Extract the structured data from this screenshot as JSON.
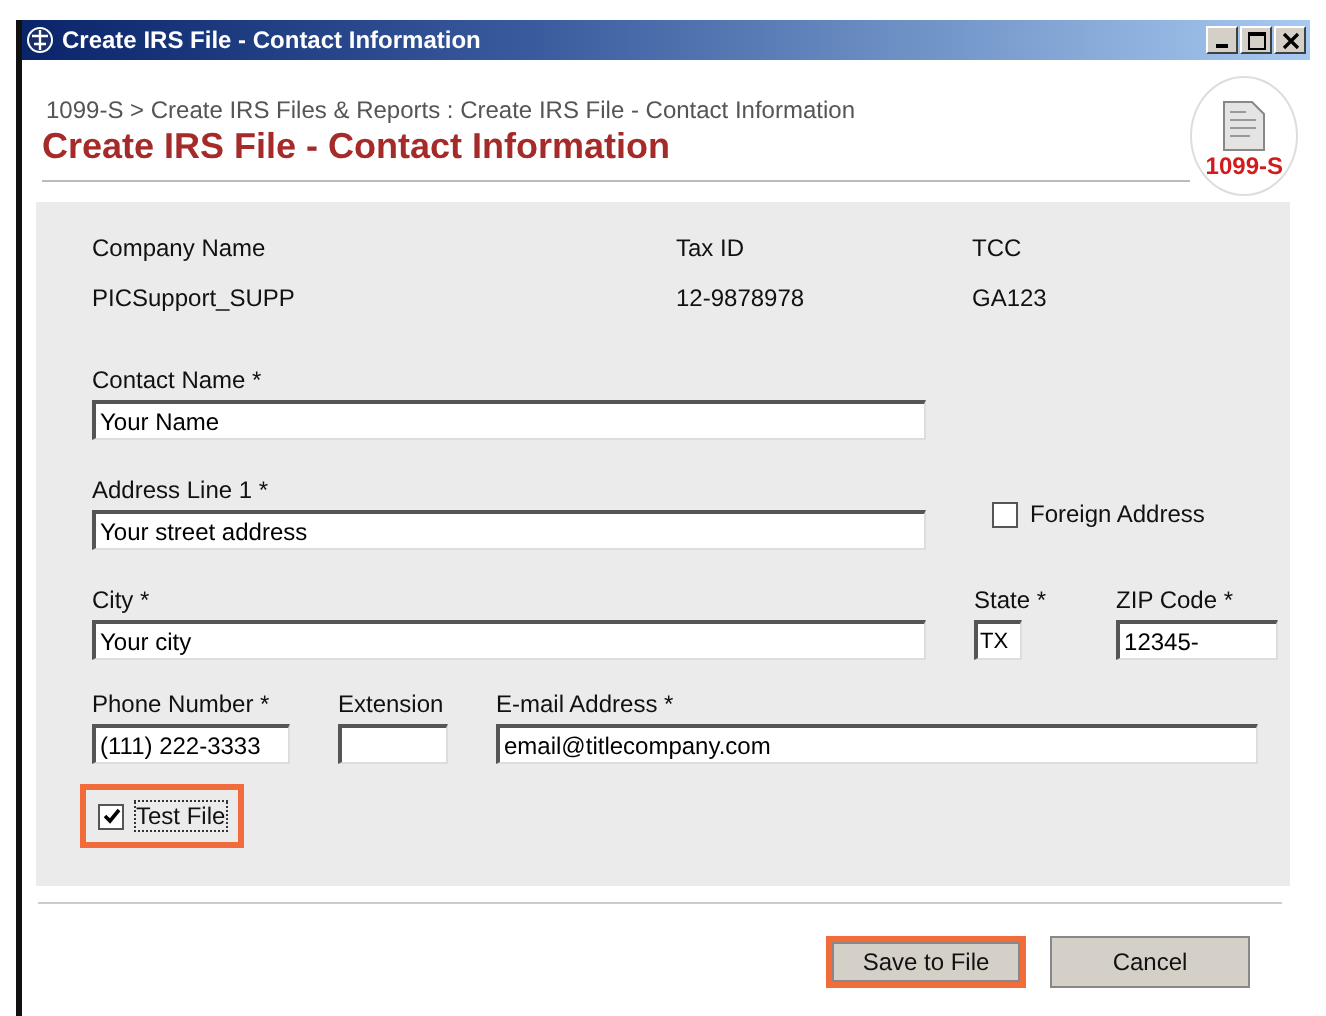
{
  "window": {
    "title": "Create IRS File - Contact Information"
  },
  "breadcrumb": "1099-S > Create IRS Files & Reports : Create IRS File - Contact Information",
  "heading": "Create IRS File - Contact Information",
  "logo": {
    "label": "1099-S"
  },
  "info": [
    {
      "label": "Company Name",
      "value": "PICSupport_SUPP"
    },
    {
      "label": "Tax ID",
      "value": "12-9878978"
    },
    {
      "label": "TCC",
      "value": "GA123"
    }
  ],
  "contact_name": {
    "label": "Contact Name *",
    "value": "Your Name"
  },
  "address_line_1": {
    "label": "Address Line 1 *",
    "value": "Your street address"
  },
  "foreign_address": {
    "label": "Foreign Address",
    "checked": false
  },
  "city": {
    "label": "City *",
    "value": "Your city"
  },
  "state": {
    "label": "State *",
    "value": "TX"
  },
  "zip_code": {
    "label": "ZIP Code *",
    "value": "12345-"
  },
  "phone_number": {
    "label": "Phone Number *",
    "value": "(111) 222-3333"
  },
  "extension": {
    "label": "Extension"
  },
  "email_address": {
    "label": "E-mail Address *",
    "value": "email@titlecompany.com"
  },
  "test_file": {
    "label": "Test File",
    "checked": true,
    "highlighted": true
  },
  "buttons": [
    {
      "label": "Save to File",
      "highlighted": true
    },
    {
      "label": "Cancel",
      "highlighted": false
    }
  ]
}
